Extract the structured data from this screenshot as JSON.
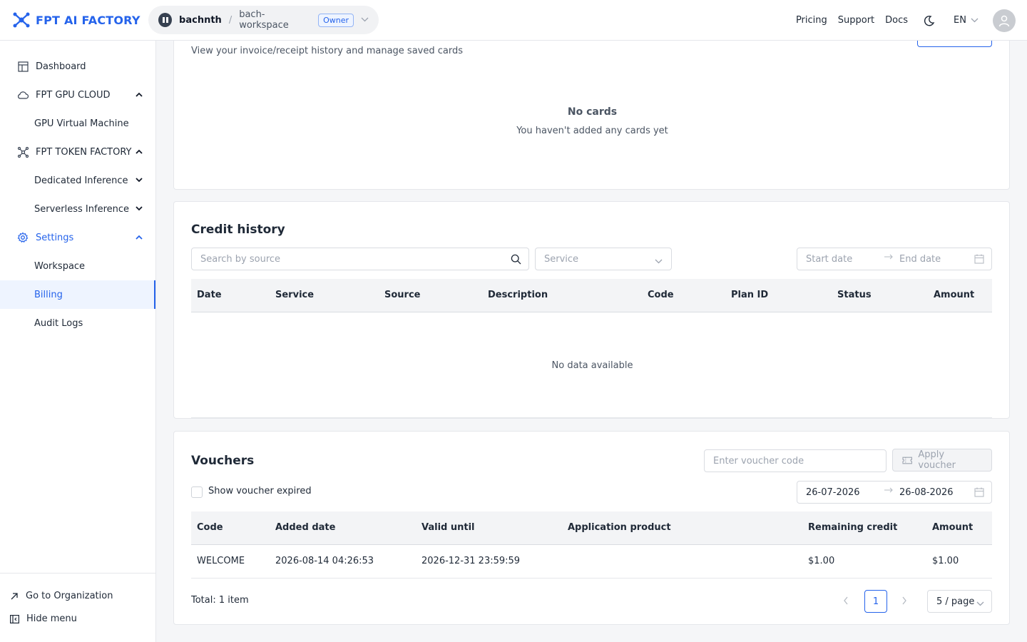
{
  "header": {
    "logo_text": "FPT AI FACTORY",
    "user": "bachnth",
    "separator": "/",
    "workspace": "bach-workspace",
    "role_badge": "Owner",
    "links": [
      "Pricing",
      "Support",
      "Docs"
    ],
    "language": "EN"
  },
  "sidebar": {
    "items": [
      {
        "label": "Dashboard",
        "icon": "dashboard-icon"
      },
      {
        "label": "FPT GPU CLOUD",
        "icon": "cloud-icon"
      },
      {
        "label": "GPU Virtual Machine"
      },
      {
        "label": "FPT TOKEN FACTORY",
        "icon": "network-icon"
      },
      {
        "label": "Dedicated Inference"
      },
      {
        "label": "Serverless Inference"
      },
      {
        "label": "Settings",
        "icon": "gear-icon"
      },
      {
        "label": "Workspace"
      },
      {
        "label": "Billing"
      },
      {
        "label": "Audit Logs"
      }
    ],
    "bottom": {
      "go_to_org": "Go to Organization",
      "hide_menu": "Hide menu"
    }
  },
  "payment": {
    "subtitle": "View your invoice/receipt history and manage saved cards",
    "empty_title": "No cards",
    "empty_text": "You haven't added any cards yet"
  },
  "credit_history": {
    "title": "Credit history",
    "search_placeholder": "Search by source",
    "service_placeholder": "Service",
    "start_placeholder": "Start date",
    "end_placeholder": "End date",
    "columns": [
      "Date",
      "Service",
      "Source",
      "Description",
      "Code",
      "Plan ID",
      "Status",
      "Amount"
    ],
    "empty": "No data available"
  },
  "vouchers": {
    "title": "Vouchers",
    "voucher_placeholder": "Enter voucher code",
    "apply_label": "Apply voucher",
    "show_expired": "Show voucher expired",
    "date_from": "26-07-2026",
    "date_to": "26-08-2026",
    "columns": [
      "Code",
      "Added date",
      "Valid until",
      "Application product",
      "Remaining credit",
      "Amount"
    ],
    "rows": [
      {
        "code": "WELCOME",
        "added": "2026-08-14 04:26:53",
        "valid": "2026-12-31 23:59:59",
        "product": "",
        "remaining": "$1.00",
        "amount": "$1.00"
      }
    ],
    "total": "Total: 1 item",
    "page": "1",
    "page_size": "5 / page"
  },
  "colors": {
    "accent": "#2563eb",
    "border": "#e5e7eb"
  }
}
